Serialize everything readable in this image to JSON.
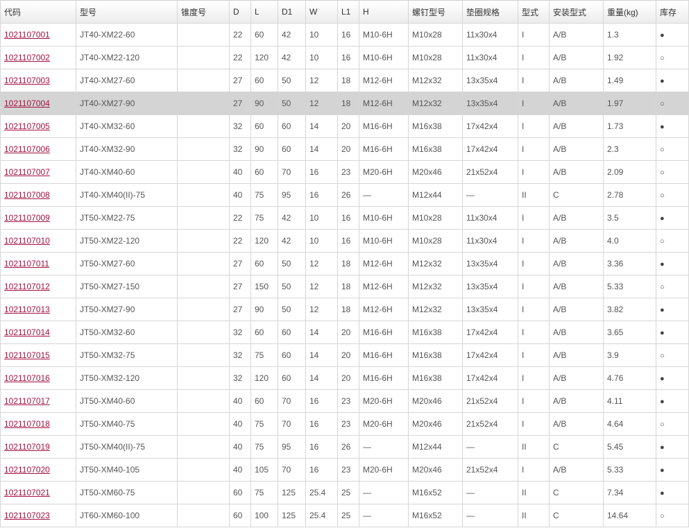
{
  "headers": [
    "代码",
    "型号",
    "锥度号",
    "D",
    "L",
    "D1",
    "W",
    "L1",
    "H",
    "螺钉型号",
    "垫圈规格",
    "型式",
    "安装型式",
    "重量(kg)",
    "库存"
  ],
  "rows": [
    {
      "code": "1021107001",
      "model": "JT40-XM22-60",
      "taper": "",
      "D": "22",
      "L": "60",
      "D1": "42",
      "W": "10",
      "L1": "16",
      "H": "M10-6H",
      "screw": "M10x28",
      "washer": "11x30x4",
      "form": "I",
      "mount": "A/B",
      "weight": "1.3",
      "stock": "●"
    },
    {
      "code": "1021107002",
      "model": "JT40-XM22-120",
      "taper": "",
      "D": "22",
      "L": "120",
      "D1": "42",
      "W": "10",
      "L1": "16",
      "H": "M10-6H",
      "screw": "M10x28",
      "washer": "11x30x4",
      "form": "I",
      "mount": "A/B",
      "weight": "1.92",
      "stock": "○"
    },
    {
      "code": "1021107003",
      "model": "JT40-XM27-60",
      "taper": "",
      "D": "27",
      "L": "60",
      "D1": "50",
      "W": "12",
      "L1": "18",
      "H": "M12-6H",
      "screw": "M12x32",
      "washer": "13x35x4",
      "form": "I",
      "mount": "A/B",
      "weight": "1.49",
      "stock": "●"
    },
    {
      "code": "1021107004",
      "model": "JT40-XM27-90",
      "taper": "",
      "D": "27",
      "L": "90",
      "D1": "50",
      "W": "12",
      "L1": "18",
      "H": "M12-6H",
      "screw": "M12x32",
      "washer": "13x35x4",
      "form": "I",
      "mount": "A/B",
      "weight": "1.97",
      "stock": "○"
    },
    {
      "code": "1021107005",
      "model": "JT40-XM32-60",
      "taper": "",
      "D": "32",
      "L": "60",
      "D1": "60",
      "W": "14",
      "L1": "20",
      "H": "M16-6H",
      "screw": "M16x38",
      "washer": "17x42x4",
      "form": "I",
      "mount": "A/B",
      "weight": "1.73",
      "stock": "●"
    },
    {
      "code": "1021107006",
      "model": "JT40-XM32-90",
      "taper": "",
      "D": "32",
      "L": "90",
      "D1": "60",
      "W": "14",
      "L1": "20",
      "H": "M16-6H",
      "screw": "M16x38",
      "washer": "17x42x4",
      "form": "I",
      "mount": "A/B",
      "weight": "2.3",
      "stock": "○"
    },
    {
      "code": "1021107007",
      "model": "JT40-XM40-60",
      "taper": "",
      "D": "40",
      "L": "60",
      "D1": "70",
      "W": "16",
      "L1": "23",
      "H": "M20-6H",
      "screw": "M20x46",
      "washer": "21x52x4",
      "form": "I",
      "mount": "A/B",
      "weight": "2.09",
      "stock": "○"
    },
    {
      "code": "1021107008",
      "model": "JT40-XM40(II)-75",
      "taper": "",
      "D": "40",
      "L": "75",
      "D1": "95",
      "W": "16",
      "L1": "26",
      "H": "—",
      "screw": "M12x44",
      "washer": "—",
      "form": "II",
      "mount": "C",
      "weight": "2.78",
      "stock": "○"
    },
    {
      "code": "1021107009",
      "model": "JT50-XM22-75",
      "taper": "",
      "D": "22",
      "L": "75",
      "D1": "42",
      "W": "10",
      "L1": "16",
      "H": "M10-6H",
      "screw": "M10x28",
      "washer": "11x30x4",
      "form": "I",
      "mount": "A/B",
      "weight": "3.5",
      "stock": "●"
    },
    {
      "code": "1021107010",
      "model": "JT50-XM22-120",
      "taper": "",
      "D": "22",
      "L": "120",
      "D1": "42",
      "W": "10",
      "L1": "16",
      "H": "M10-6H",
      "screw": "M10x28",
      "washer": "11x30x4",
      "form": "I",
      "mount": "A/B",
      "weight": "4.0",
      "stock": "○"
    },
    {
      "code": "1021107011",
      "model": "JT50-XM27-60",
      "taper": "",
      "D": "27",
      "L": "60",
      "D1": "50",
      "W": "12",
      "L1": "18",
      "H": "M12-6H",
      "screw": "M12x32",
      "washer": "13x35x4",
      "form": "I",
      "mount": "A/B",
      "weight": "3.36",
      "stock": "●"
    },
    {
      "code": "1021107012",
      "model": "JT50-XM27-150",
      "taper": "",
      "D": "27",
      "L": "150",
      "D1": "50",
      "W": "12",
      "L1": "18",
      "H": "M12-6H",
      "screw": "M12x32",
      "washer": "13x35x4",
      "form": "I",
      "mount": "A/B",
      "weight": "5.33",
      "stock": "○"
    },
    {
      "code": "1021107013",
      "model": "JT50-XM27-90",
      "taper": "",
      "D": "27",
      "L": "90",
      "D1": "50",
      "W": "12",
      "L1": "18",
      "H": "M12-6H",
      "screw": "M12x32",
      "washer": "13x35x4",
      "form": "I",
      "mount": "A/B",
      "weight": "3.82",
      "stock": "●"
    },
    {
      "code": "1021107014",
      "model": "JT50-XM32-60",
      "taper": "",
      "D": "32",
      "L": "60",
      "D1": "60",
      "W": "14",
      "L1": "20",
      "H": "M16-6H",
      "screw": "M16x38",
      "washer": "17x42x4",
      "form": "I",
      "mount": "A/B",
      "weight": "3.65",
      "stock": "●"
    },
    {
      "code": "1021107015",
      "model": "JT50-XM32-75",
      "taper": "",
      "D": "32",
      "L": "75",
      "D1": "60",
      "W": "14",
      "L1": "20",
      "H": "M16-6H",
      "screw": "M16x38",
      "washer": "17x42x4",
      "form": "I",
      "mount": "A/B",
      "weight": "3.9",
      "stock": "○"
    },
    {
      "code": "1021107016",
      "model": "JT50-XM32-120",
      "taper": "",
      "D": "32",
      "L": "120",
      "D1": "60",
      "W": "14",
      "L1": "20",
      "H": "M16-6H",
      "screw": "M16x38",
      "washer": "17x42x4",
      "form": "I",
      "mount": "A/B",
      "weight": "4.76",
      "stock": "●"
    },
    {
      "code": "1021107017",
      "model": "JT50-XM40-60",
      "taper": "",
      "D": "40",
      "L": "60",
      "D1": "70",
      "W": "16",
      "L1": "23",
      "H": "M20-6H",
      "screw": "M20x46",
      "washer": "21x52x4",
      "form": "I",
      "mount": "A/B",
      "weight": "4.11",
      "stock": "●"
    },
    {
      "code": "1021107018",
      "model": "JT50-XM40-75",
      "taper": "",
      "D": "40",
      "L": "75",
      "D1": "70",
      "W": "16",
      "L1": "23",
      "H": "M20-6H",
      "screw": "M20x46",
      "washer": "21x52x4",
      "form": "I",
      "mount": "A/B",
      "weight": "4.64",
      "stock": "○"
    },
    {
      "code": "1021107019",
      "model": "JT50-XM40(II)-75",
      "taper": "",
      "D": "40",
      "L": "75",
      "D1": "95",
      "W": "16",
      "L1": "26",
      "H": "—",
      "screw": "M12x44",
      "washer": "—",
      "form": "II",
      "mount": "C",
      "weight": "5.45",
      "stock": "●"
    },
    {
      "code": "1021107020",
      "model": "JT50-XM40-105",
      "taper": "",
      "D": "40",
      "L": "105",
      "D1": "70",
      "W": "16",
      "L1": "23",
      "H": "M20-6H",
      "screw": "M20x46",
      "washer": "21x52x4",
      "form": "I",
      "mount": "A/B",
      "weight": "5.33",
      "stock": "●"
    },
    {
      "code": "1021107021",
      "model": "JT50-XM60-75",
      "taper": "",
      "D": "60",
      "L": "75",
      "D1": "125",
      "W": "25.4",
      "L1": "25",
      "H": "—",
      "screw": "M16x52",
      "washer": "—",
      "form": "II",
      "mount": "C",
      "weight": "7.34",
      "stock": "●"
    },
    {
      "code": "1021107023",
      "model": "JT60-XM60-100",
      "taper": "",
      "D": "60",
      "L": "100",
      "D1": "125",
      "W": "25.4",
      "L1": "25",
      "H": "—",
      "screw": "M16x52",
      "washer": "—",
      "form": "II",
      "mount": "C",
      "weight": "14.64",
      "stock": "○"
    }
  ],
  "highlighted_row_index": 3,
  "colors": {
    "link": "#a4123f",
    "highlight_row": "#d4d4d4",
    "border": "#d6d6d6"
  }
}
